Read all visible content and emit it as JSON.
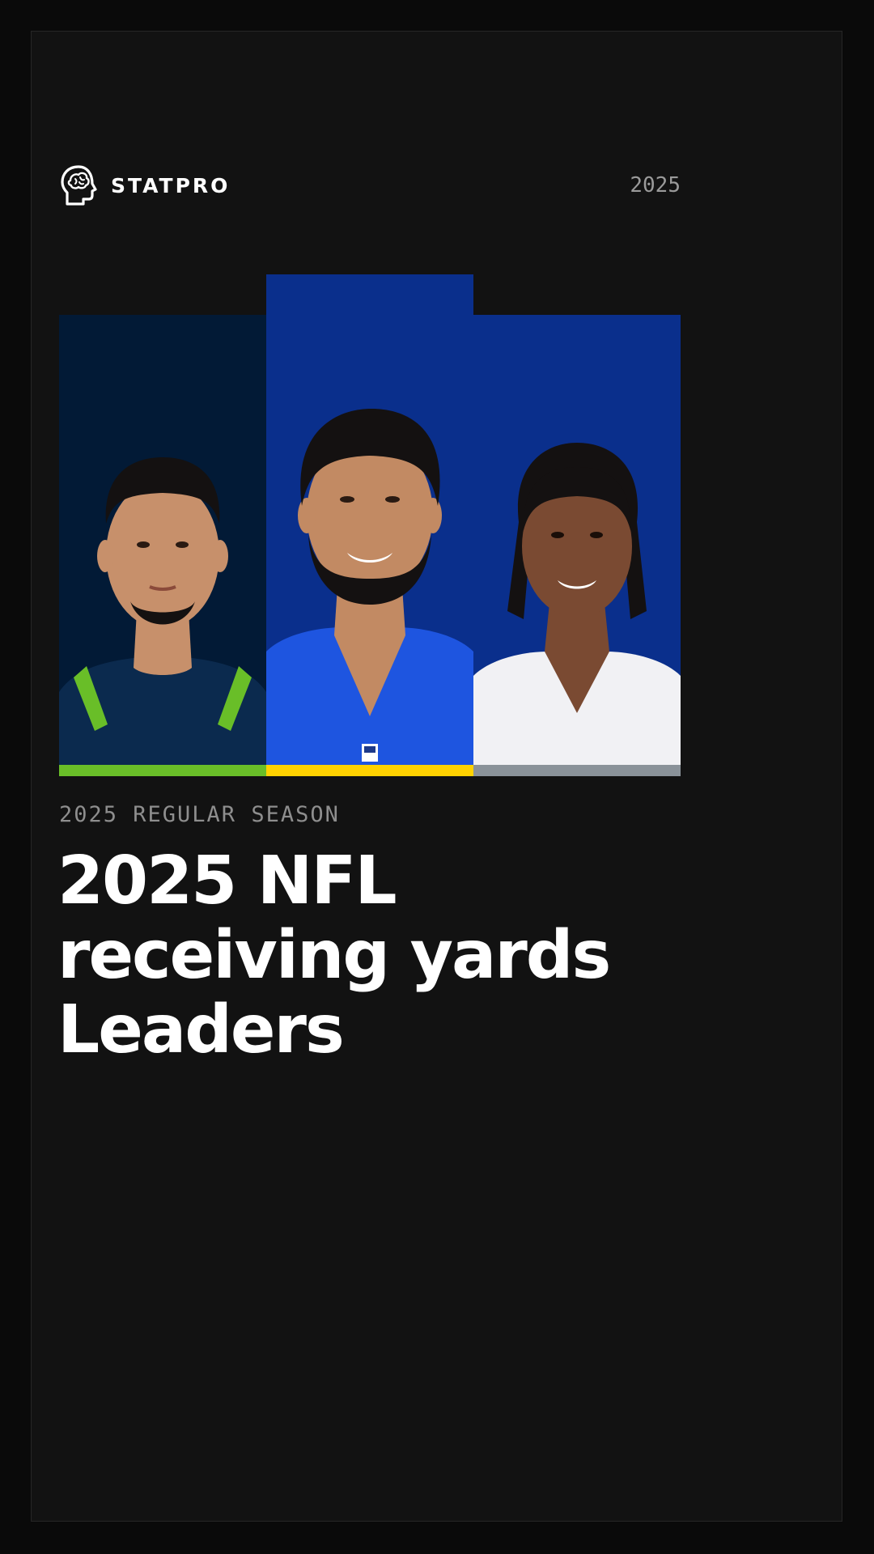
{
  "brand": {
    "name": "STATPRO",
    "icon": "brain-head-icon"
  },
  "header": {
    "year": "2025"
  },
  "players": [
    {
      "team_jersey": "navy",
      "background_color": "#021a36",
      "jersey_color": "#0b2a4e",
      "accent_color": "#69be28",
      "stripe_color": "#69be28",
      "skin_color": "#c7906b",
      "hair_color": "#141111"
    },
    {
      "team_jersey": "royal blue",
      "background_color": "#0a2f8c",
      "jersey_color": "#1e55e0",
      "accent_color": "#ffd200",
      "stripe_color": "#ffd200",
      "skin_color": "#c28a63",
      "hair_color": "#141111"
    },
    {
      "team_jersey": "white",
      "background_color": "#0a2f8c",
      "jersey_color": "#f1f1f4",
      "accent_color": "#8a9299",
      "stripe_color": "#8a9299",
      "skin_color": "#7a4a32",
      "hair_color": "#141111"
    }
  ],
  "kicker": "2025 REGULAR SEASON",
  "title": {
    "line1": "2025 NFL",
    "line2": "receiving yards",
    "line3": "Leaders"
  }
}
